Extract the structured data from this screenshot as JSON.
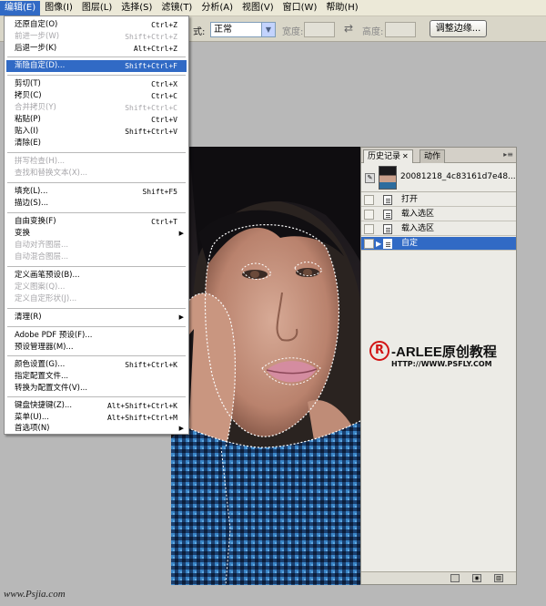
{
  "menubar": {
    "items": [
      "编辑(E)",
      "图像(I)",
      "图层(L)",
      "选择(S)",
      "滤镜(T)",
      "分析(A)",
      "视图(V)",
      "窗口(W)",
      "帮助(H)"
    ]
  },
  "options": {
    "style_label": "式:",
    "style_value": "正常",
    "width_label": "宽度:",
    "height_label": "高度:",
    "refine_button": "调整边缘..."
  },
  "edit_menu": {
    "items": [
      {
        "label": "还原自定(O)",
        "shortcut": "Ctrl+Z"
      },
      {
        "label": "前进一步(W)",
        "shortcut": "Shift+Ctrl+Z"
      },
      {
        "label": "后退一步(K)",
        "shortcut": "Alt+Ctrl+Z"
      },
      {
        "label": "渐隐自定(D)...",
        "shortcut": "Shift+Ctrl+F"
      },
      {
        "label": "剪切(T)",
        "shortcut": "Ctrl+X"
      },
      {
        "label": "拷贝(C)",
        "shortcut": "Ctrl+C"
      },
      {
        "label": "合并拷贝(Y)",
        "shortcut": "Shift+Ctrl+C"
      },
      {
        "label": "粘贴(P)",
        "shortcut": "Ctrl+V"
      },
      {
        "label": "贴入(I)",
        "shortcut": "Shift+Ctrl+V"
      },
      {
        "label": "清除(E)",
        "shortcut": ""
      },
      {
        "label": "拼写检查(H)...",
        "shortcut": ""
      },
      {
        "label": "查找和替换文本(X)...",
        "shortcut": ""
      },
      {
        "label": "填充(L)...",
        "shortcut": "Shift+F5"
      },
      {
        "label": "描边(S)...",
        "shortcut": ""
      },
      {
        "label": "自由变换(F)",
        "shortcut": "Ctrl+T"
      },
      {
        "label": "变换",
        "shortcut": ""
      },
      {
        "label": "自动对齐图层...",
        "shortcut": ""
      },
      {
        "label": "自动混合图层...",
        "shortcut": ""
      },
      {
        "label": "定义画笔预设(B)...",
        "shortcut": ""
      },
      {
        "label": "定义图案(Q)...",
        "shortcut": ""
      },
      {
        "label": "定义自定形状(J)...",
        "shortcut": ""
      },
      {
        "label": "清理(R)",
        "shortcut": ""
      },
      {
        "label": "Adobe PDF 预设(F)...",
        "shortcut": ""
      },
      {
        "label": "预设管理器(M)...",
        "shortcut": ""
      },
      {
        "label": "颜色设置(G)...",
        "shortcut": "Shift+Ctrl+K"
      },
      {
        "label": "指定配置文件...",
        "shortcut": ""
      },
      {
        "label": "转换为配置文件(V)...",
        "shortcut": ""
      },
      {
        "label": "键盘快捷键(Z)...",
        "shortcut": "Alt+Shift+Ctrl+K"
      },
      {
        "label": "菜单(U)...",
        "shortcut": "Alt+Shift+Ctrl+M"
      },
      {
        "label": "首选项(N)",
        "shortcut": ""
      }
    ]
  },
  "history": {
    "tab_history": "历史记录",
    "tab_actions": "动作",
    "snapshot_name": "20081218_4c83161d7e48...",
    "states": [
      "打开",
      "载入选区",
      "载入选区",
      "自定"
    ]
  },
  "watermark": {
    "reg_mark": "R",
    "brand": "-ARLEE原创教程",
    "url": "HTTP://WWW.PSFLY.COM",
    "site": "www.Psjia.com"
  },
  "colors": {
    "highlight": "#316ac5",
    "menu_bg": "#ffffff",
    "panel_bg": "#ecebe6",
    "brand_red": "#d21515"
  }
}
